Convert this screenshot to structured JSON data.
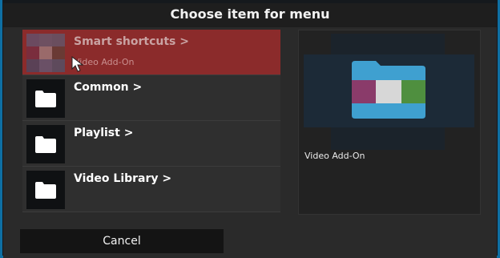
{
  "dialog": {
    "title": "Choose item for menu"
  },
  "list": {
    "items": [
      {
        "label": "Smart shortcuts  >",
        "sub": "Video Add-On",
        "focused": true
      },
      {
        "label": "Common  >"
      },
      {
        "label": "Playlist  >"
      },
      {
        "label": "Video Library  >"
      }
    ]
  },
  "preview": {
    "caption": "Video Add-On"
  },
  "buttons": {
    "cancel": "Cancel"
  },
  "colors": {
    "focus": "#8b2b2b",
    "border": "#0e6fa3"
  }
}
